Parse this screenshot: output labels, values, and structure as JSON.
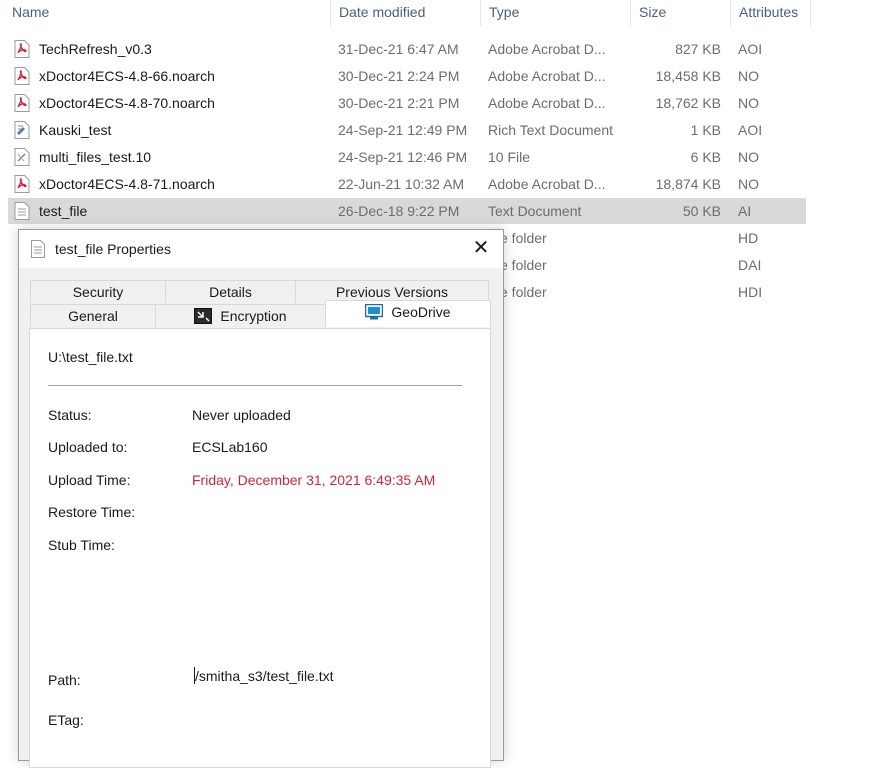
{
  "columns": {
    "name": "Name",
    "date_modified": "Date modified",
    "type": "Type",
    "size": "Size",
    "attributes": "Attributes"
  },
  "files": [
    {
      "name": "TechRefresh_v0.3",
      "date": "31-Dec-21 6:47 AM",
      "type": "Adobe Acrobat D...",
      "size": "827 KB",
      "attr": "AOI",
      "icon": "pdf-icon"
    },
    {
      "name": "xDoctor4ECS-4.8-66.noarch",
      "date": "30-Dec-21 2:24 PM",
      "type": "Adobe Acrobat D...",
      "size": "18,458 KB",
      "attr": "NO",
      "icon": "pdf-icon"
    },
    {
      "name": "xDoctor4ECS-4.8-70.noarch",
      "date": "30-Dec-21 2:21 PM",
      "type": "Adobe Acrobat D...",
      "size": "18,762 KB",
      "attr": "NO",
      "icon": "pdf-icon"
    },
    {
      "name": "Kauski_test",
      "date": "24-Sep-21 12:49 PM",
      "type": "Rich Text Document",
      "size": "1 KB",
      "attr": "AOI",
      "icon": "rich-text-icon"
    },
    {
      "name": "multi_files_test.10",
      "date": "24-Sep-21 12:46 PM",
      "type": "10 File",
      "size": "6 KB",
      "attr": "NO",
      "icon": "generic-file-icon"
    },
    {
      "name": "xDoctor4ECS-4.8-71.noarch",
      "date": "22-Jun-21 10:32 AM",
      "type": "Adobe Acrobat D...",
      "size": "18,874 KB",
      "attr": "NO",
      "icon": "pdf-icon"
    },
    {
      "name": "test_file",
      "date": "26-Dec-18 9:22 PM",
      "type": "Text Document",
      "size": "50 KB",
      "attr": "AI",
      "icon": "text-file-icon",
      "selected": true
    }
  ],
  "hidden_rows": [
    {
      "type": "e folder",
      "attr": "HD"
    },
    {
      "type": "e folder",
      "attr": "DAI"
    },
    {
      "type": "e folder",
      "attr": "HDI"
    }
  ],
  "dialog": {
    "title": "test_file Properties",
    "close_glyph": "✕",
    "tabs_top": [
      "Security",
      "Details",
      "Previous Versions"
    ],
    "tabs_bottom": [
      "General",
      "Encryption",
      "GeoDrive"
    ],
    "active_tab": "GeoDrive",
    "file_path": "U:\\test_file.txt",
    "fields": {
      "status_label": "Status:",
      "status_value": "Never uploaded",
      "uploaded_to_label": "Uploaded to:",
      "uploaded_to_value": "ECSLab160",
      "upload_time_label": "Upload Time:",
      "upload_time_value": "Friday, December 31, 2021 6:49:35 AM",
      "restore_time_label": "Restore Time:",
      "stub_time_label": "Stub Time:",
      "path_label": "Path:",
      "path_value": "/smitha_s3/test_file.txt",
      "etag_label": "ETag:"
    },
    "colors": {
      "upload_time_value": "#d0243a",
      "selected_row": "#d9d9d9"
    }
  }
}
